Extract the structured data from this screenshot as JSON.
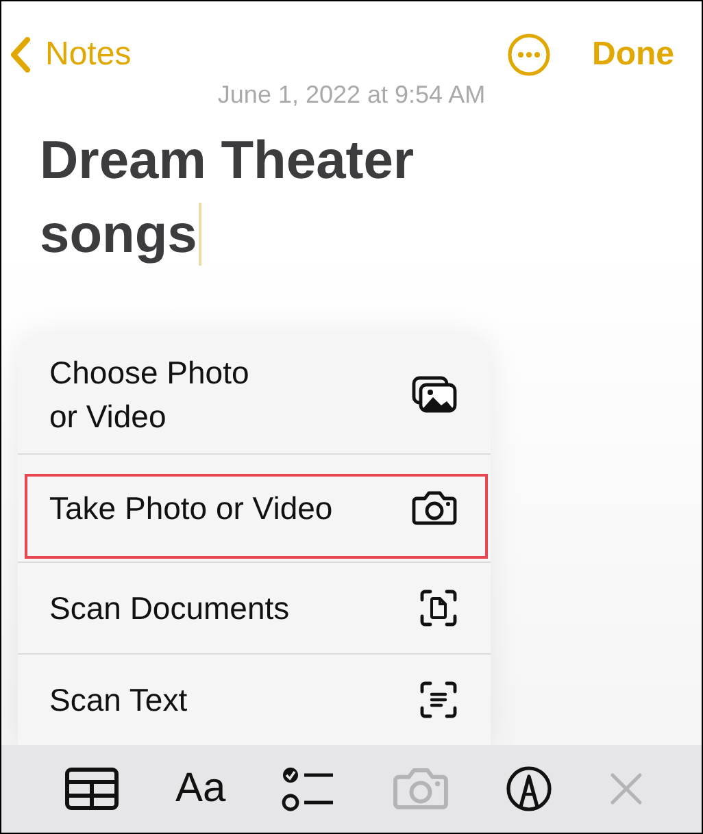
{
  "nav": {
    "back_label": "Notes",
    "done_label": "Done"
  },
  "note": {
    "date": "June 1, 2022 at 9:54 AM",
    "title": "Dream Theater songs"
  },
  "menu": [
    {
      "kind": "photos",
      "label": "Choose Photo\nor Video",
      "highlighted": false
    },
    {
      "kind": "camera",
      "label": "Take Photo or Video",
      "highlighted": true
    },
    {
      "kind": "scan-doc",
      "label": "Scan Documents",
      "highlighted": false
    },
    {
      "kind": "scan-text",
      "label": "Scan Text",
      "highlighted": false
    }
  ],
  "toolbar": [
    {
      "kind": "table",
      "disabled": false
    },
    {
      "kind": "format",
      "label": "Aa",
      "disabled": false
    },
    {
      "kind": "checklist",
      "disabled": false
    },
    {
      "kind": "camera",
      "disabled": true
    },
    {
      "kind": "markup",
      "disabled": false
    },
    {
      "kind": "close",
      "disabled": true
    }
  ]
}
